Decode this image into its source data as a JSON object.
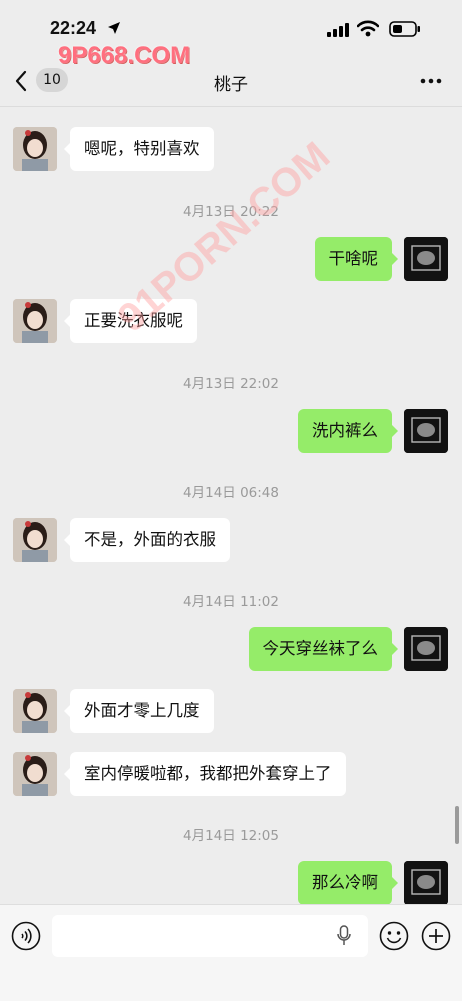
{
  "status_bar": {
    "time": "22:24"
  },
  "watermarks": {
    "top": "9P668.COM",
    "diagonal": "91PORN.COM"
  },
  "nav": {
    "unread_count": "10",
    "title": "桃子"
  },
  "messages": [
    {
      "text": "嗯呢，特别喜欢"
    },
    {
      "time": "4月13日 20:22"
    },
    {
      "text": "干啥呢"
    },
    {
      "text": "正要洗衣服呢"
    },
    {
      "time": "4月13日 22:02"
    },
    {
      "text": "洗内裤么"
    },
    {
      "time": "4月14日 06:48"
    },
    {
      "text": "不是，外面的衣服"
    },
    {
      "time": "4月14日 11:02"
    },
    {
      "text": "今天穿丝袜了么"
    },
    {
      "text": "外面才零上几度"
    },
    {
      "text": "室内停暖啦都，我都把外套穿上了"
    },
    {
      "time": "4月14日 12:05"
    },
    {
      "text": "那么冷啊"
    }
  ],
  "input": {
    "value": ""
  },
  "colors": {
    "outgoing_bubble": "#95ec69",
    "incoming_bubble": "#ffffff",
    "background": "#ededed"
  }
}
